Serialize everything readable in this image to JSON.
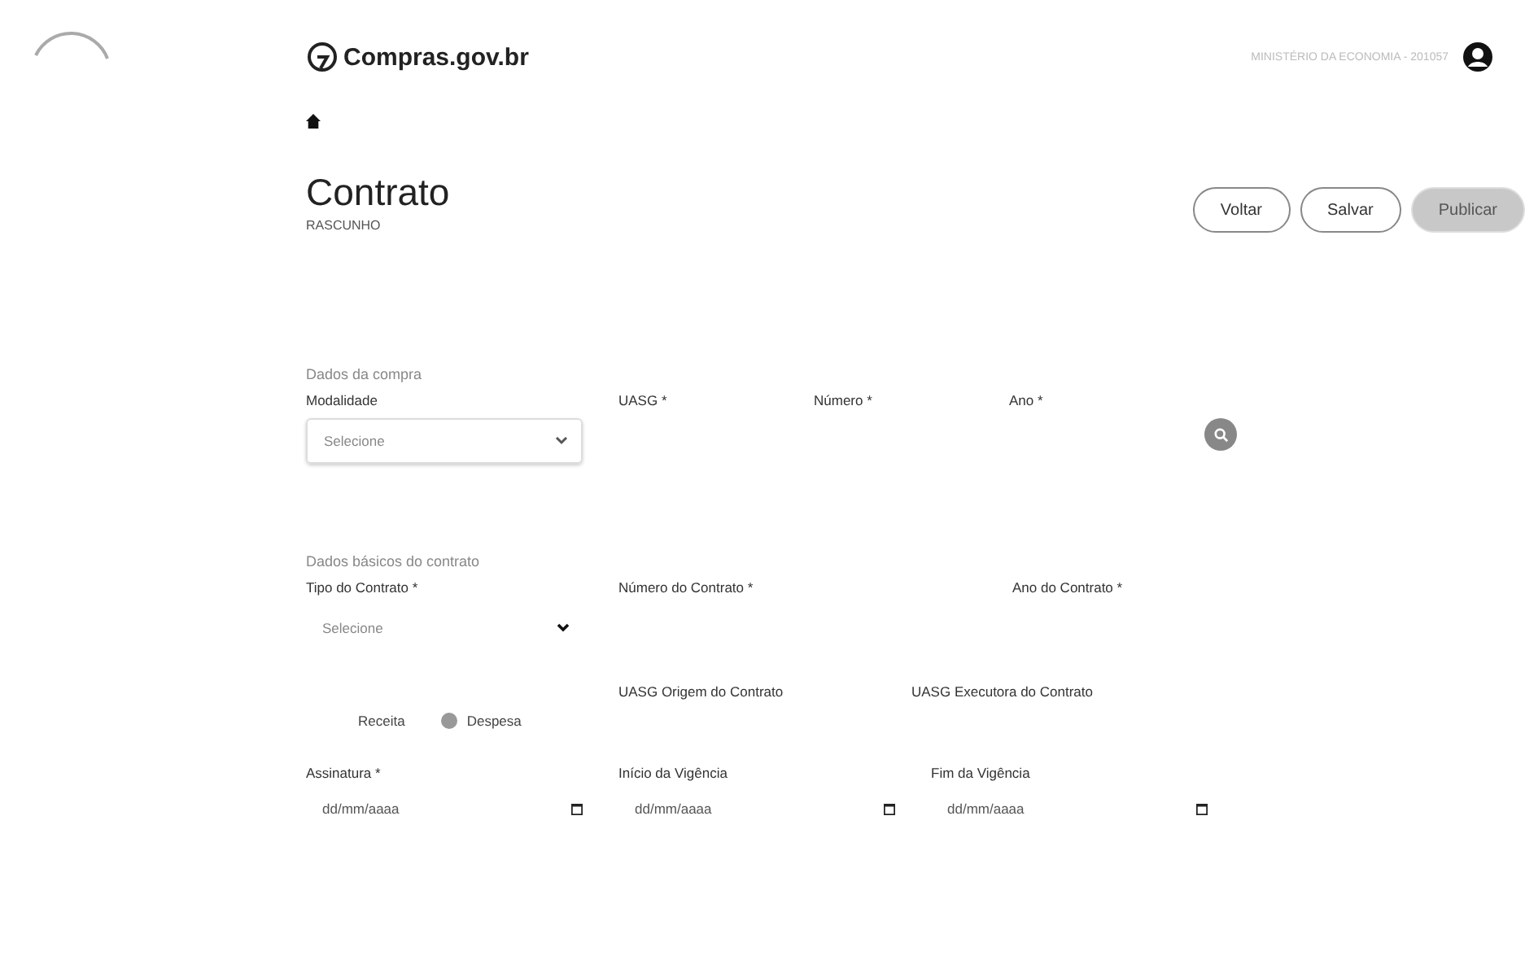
{
  "header": {
    "logo": "Compras.gov.br",
    "org": "MINISTÉRIO DA ECONOMIA - 201057"
  },
  "page": {
    "title": "Contrato",
    "status": "RASCUNHO"
  },
  "actions": [
    {
      "label": "Voltar",
      "disabled": false
    },
    {
      "label": "Salvar",
      "disabled": false
    },
    {
      "label": "Publicar",
      "disabled": true
    }
  ],
  "purchase": {
    "title": "Dados da compra",
    "modalidade": {
      "label": "Modalidade",
      "placeholder": "Selecione"
    },
    "uasg": "UASG *",
    "numero": "Número *",
    "ano": "Ano *"
  },
  "contract": {
    "title": "Dados básicos do contrato",
    "tipo": {
      "label": "Tipo do Contrato *",
      "placeholder": "Selecione"
    },
    "numero": "Número do Contrato *",
    "ano": "Ano do Contrato *",
    "radios": [
      {
        "label": "Receita",
        "selected": false
      },
      {
        "label": "Despesa",
        "selected": true
      }
    ],
    "uasg_origem": "UASG Origem do Contrato",
    "uasg_executora": "UASG Executora do Contrato",
    "dates": [
      {
        "label": "Assinatura *",
        "placeholder": "dd/mm/aaaa"
      },
      {
        "label": "Início da Vigência",
        "placeholder": "dd/mm/aaaa"
      },
      {
        "label": "Fim da Vigência",
        "placeholder": "dd/mm/aaaa"
      }
    ]
  }
}
